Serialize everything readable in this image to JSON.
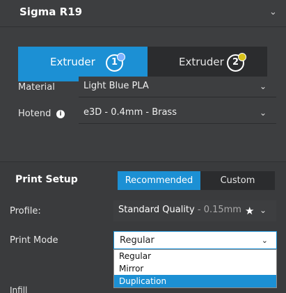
{
  "printer": {
    "name": "Sigma R19",
    "chevron_icon": "chevron-down-icon"
  },
  "extruders": [
    {
      "label": "Extruder",
      "number": "1",
      "active": true,
      "material_color": "#7fb2ff"
    },
    {
      "label": "Extruder",
      "number": "2",
      "active": false,
      "material_color": "#d8c21a"
    }
  ],
  "material": {
    "label": "Material",
    "value": "Light Blue PLA"
  },
  "hotend": {
    "label": "Hotend",
    "info_icon": "info-icon",
    "value": "e3D - 0.4mm - Brass"
  },
  "print_setup": {
    "title": "Print Setup",
    "tabs": [
      {
        "label": "Recommended",
        "active": true
      },
      {
        "label": "Custom",
        "active": false
      }
    ],
    "profile": {
      "label": "Profile:",
      "value": "Standard Quality",
      "suffix": " - 0.15mm",
      "favorite_icon": "star-icon"
    },
    "print_mode": {
      "label": "Print Mode",
      "value": "Regular",
      "options": [
        "Regular",
        "Mirror",
        "Duplication"
      ],
      "highlighted": "Duplication"
    },
    "infill": {
      "label": "Infill"
    }
  },
  "colors": {
    "accent": "#1c90d4",
    "panel": "#3d3e40",
    "dark_tab": "#2b2c2e"
  }
}
